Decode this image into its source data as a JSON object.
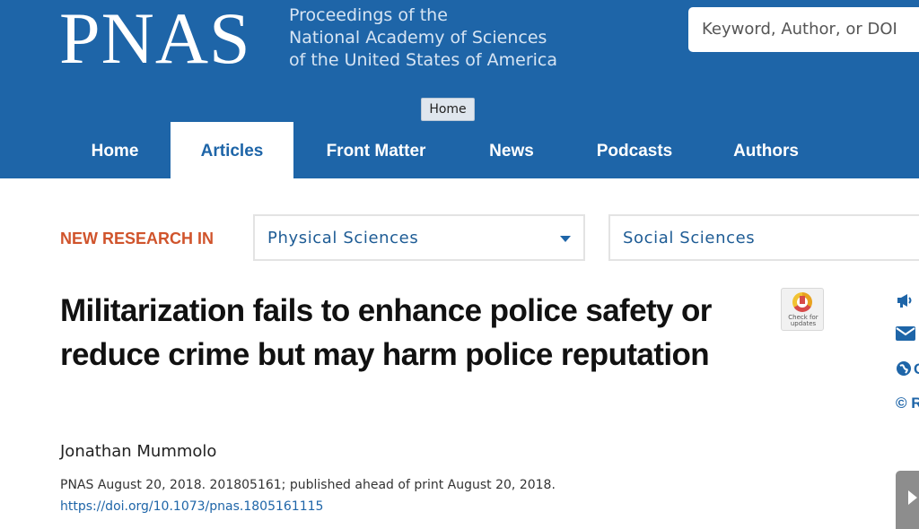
{
  "header": {
    "logo": "PNAS",
    "tagline": [
      "Proceedings of the",
      "National Academy of Sciences",
      "of the United States of America"
    ],
    "search_placeholder": "Keyword, Author, or DOI",
    "tooltip": "Home"
  },
  "nav": {
    "items": [
      {
        "label": "Home",
        "active": false
      },
      {
        "label": "Articles",
        "active": true
      },
      {
        "label": "Front Matter",
        "active": false
      },
      {
        "label": "News",
        "active": false
      },
      {
        "label": "Podcasts",
        "active": false
      },
      {
        "label": "Authors",
        "active": false
      }
    ]
  },
  "research": {
    "label": "NEW RESEARCH IN",
    "select_physical": "Physical Sciences",
    "select_social": "Social Sciences"
  },
  "article": {
    "title": "Militarization fails to enhance police safety or reduce crime but may harm police reputation",
    "author": "Jonathan Mummolo",
    "citation": "PNAS August 20, 2018. 201805161; published ahead of print August 20, 2018.",
    "doi": "https://doi.org/10.1073/pnas.1805161115",
    "badge_text": [
      "Check for",
      "updates"
    ]
  },
  "sidebar": {
    "items": [
      {
        "icon": "megaphone-icon",
        "text": ""
      },
      {
        "icon": "envelope-icon",
        "text": ""
      },
      {
        "icon": "globe-icon",
        "text": "C"
      },
      {
        "icon": "copyright-icon",
        "text": "©  R"
      }
    ]
  },
  "colors": {
    "brand_blue": "#1e65a8",
    "accent_orange": "#d0542c"
  }
}
